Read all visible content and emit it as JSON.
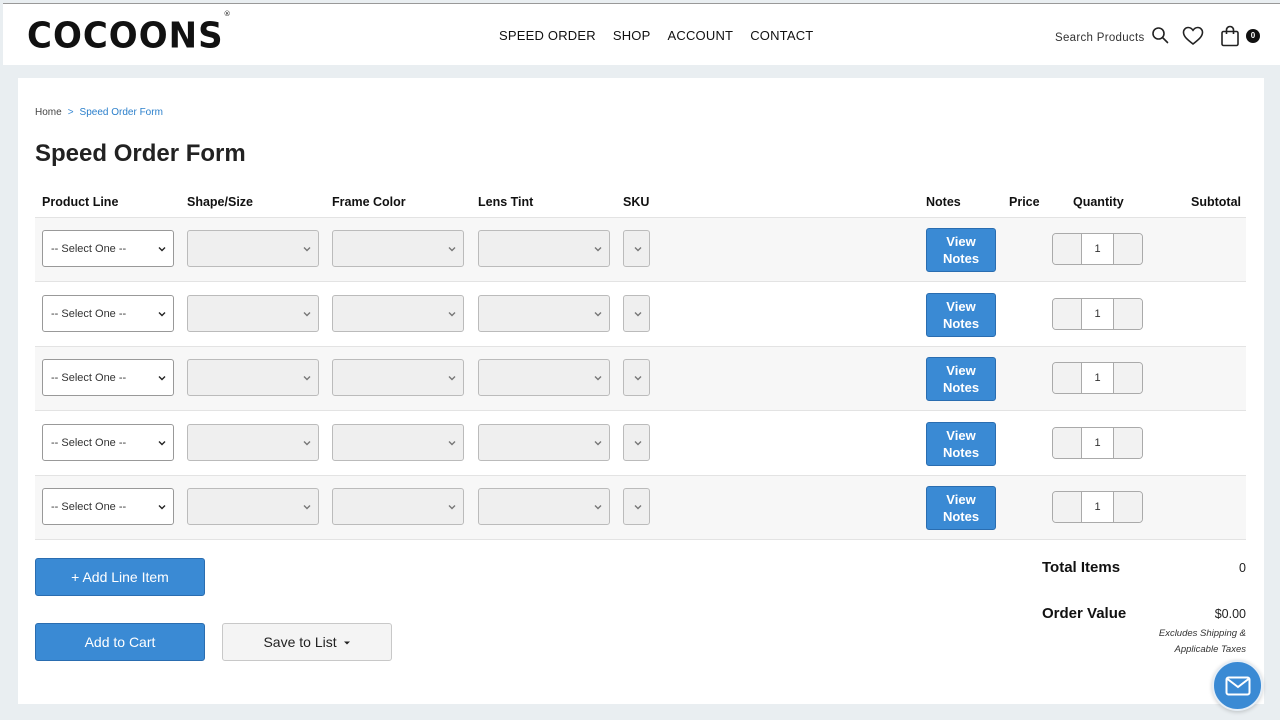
{
  "header": {
    "logo": "COCOONS",
    "logo_mark": "®",
    "nav": [
      "SPEED ORDER",
      "SHOP",
      "ACCOUNT",
      "CONTACT"
    ],
    "search_label": "Search Products",
    "cart_count": "0"
  },
  "breadcrumb": {
    "home": "Home",
    "separator": ">",
    "current": "Speed Order Form"
  },
  "page_title": "Speed Order Form",
  "columns": {
    "product_line": "Product Line",
    "shape_size": "Shape/Size",
    "frame_color": "Frame Color",
    "lens_tint": "Lens Tint",
    "sku": "SKU",
    "notes": "Notes",
    "price": "Price",
    "quantity": "Quantity",
    "subtotal": "Subtotal"
  },
  "rows": [
    {
      "product_line": "-- Select One --",
      "notes_label_1": "View",
      "notes_label_2": "Notes",
      "quantity": "1"
    },
    {
      "product_line": "-- Select One --",
      "notes_label_1": "View",
      "notes_label_2": "Notes",
      "quantity": "1"
    },
    {
      "product_line": "-- Select One --",
      "notes_label_1": "View",
      "notes_label_2": "Notes",
      "quantity": "1"
    },
    {
      "product_line": "-- Select One --",
      "notes_label_1": "View",
      "notes_label_2": "Notes",
      "quantity": "1"
    },
    {
      "product_line": "-- Select One --",
      "notes_label_1": "View",
      "notes_label_2": "Notes",
      "quantity": "1"
    }
  ],
  "actions": {
    "add_line_item": "+ Add Line Item",
    "add_to_cart": "Add to Cart",
    "save_to_list": "Save to List"
  },
  "totals": {
    "total_items_label": "Total Items",
    "total_items_value": "0",
    "order_value_label": "Order Value",
    "order_value_value": "$0.00",
    "disclaimer_1": "Excludes Shipping &",
    "disclaimer_2": "Applicable Taxes"
  },
  "colors": {
    "accent": "#3a8ad4",
    "link": "#2b7fcb"
  }
}
